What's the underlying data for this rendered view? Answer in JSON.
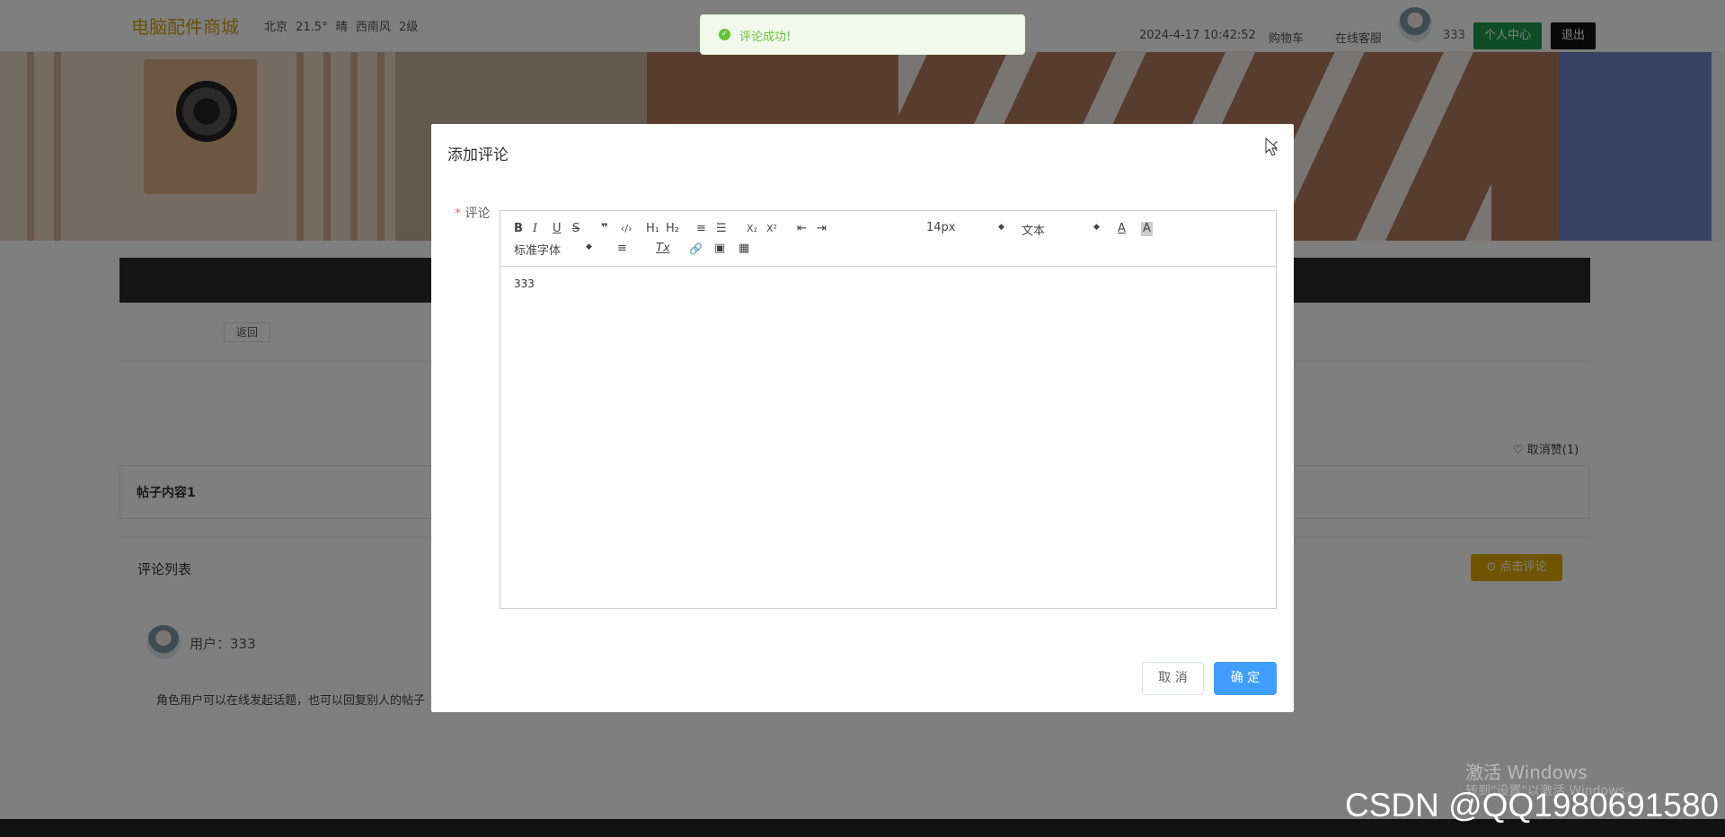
{
  "header": {
    "brand": "电脑配件商城",
    "weather": "北京 21.5° 晴 西南风 2级",
    "datetime": "2024-4-17 10:42:52",
    "nav_cart": "购物车",
    "nav_service": "在线客服",
    "username": "333",
    "btn_center": "个人中心",
    "btn_logout": "退出"
  },
  "page": {
    "back_label": "返回",
    "like_label": "♡ 取消赞(1)",
    "post_content": "帖子内容1",
    "comments_title": "评论列表",
    "comment_button": "⊙ 点击评论",
    "comment_user": "用户：333",
    "comment_body": "角色用户可以在线发起话题，也可以回复别人的帖子"
  },
  "toast": {
    "icon": "check-circle-icon",
    "text": "评论成功!"
  },
  "dialog": {
    "title": "添加评论",
    "close": "×",
    "field_required": "*",
    "field_label": "评论",
    "toolbar": {
      "bold": "B",
      "italic": "I",
      "underline": "U",
      "strike": "S",
      "quote": "❞",
      "code": "‹/›",
      "h1": "H₁",
      "h2": "H₂",
      "ordered_list": "≡",
      "bullet_list": "☰",
      "subscript": "X₂",
      "superscript": "X²",
      "indent_out": "⇤",
      "indent_in": "⇥",
      "size_select": "14px",
      "header_select": "文本",
      "color": "A",
      "background": "A",
      "font_select": "标准字体",
      "align": "≡",
      "clean": "Tx",
      "link": "🔗",
      "image": "▣",
      "video": "▦"
    },
    "editor_content": "333",
    "cancel": "取 消",
    "ok": "确 定"
  },
  "os_watermark": {
    "line1": "激活 Windows",
    "line2": "转到\"设置\"以激活 Windows。"
  },
  "csdn_watermark": "CSDN @QQ1980691580"
}
